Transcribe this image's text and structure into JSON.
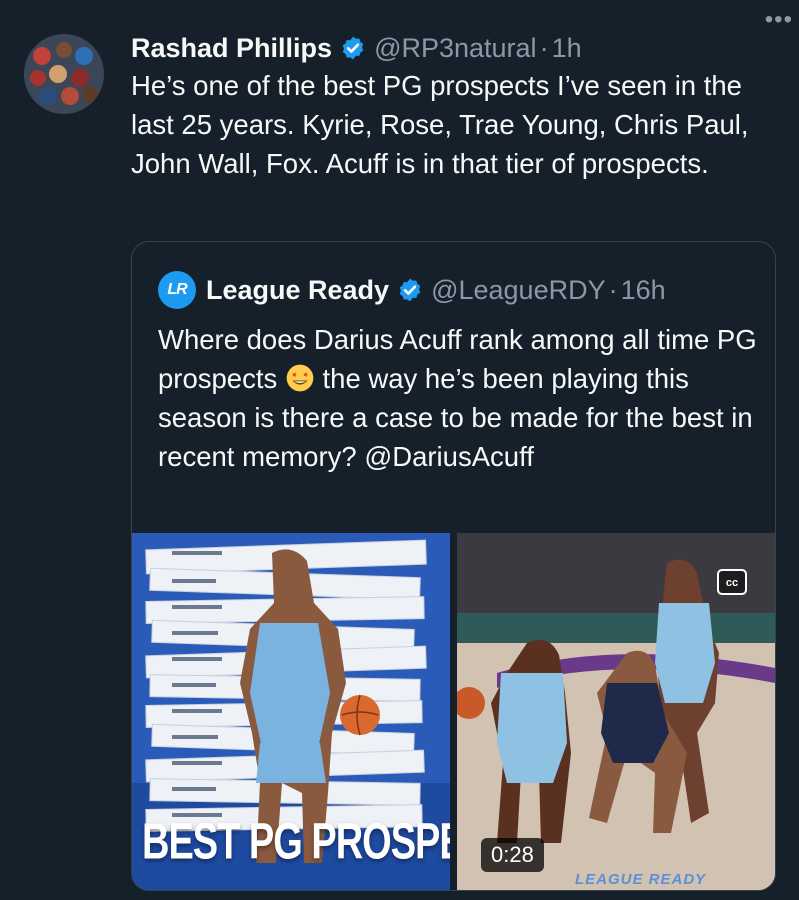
{
  "tweet": {
    "author_name": "Rashad Phillips",
    "handle": "@RP3natural",
    "separator": "·",
    "time": "1h",
    "more": "•••",
    "text": "He’s one of the best PG prospects I’ve seen in the last 25 years. Kyrie, Rose, Trae Young, Chris Paul, John Wall, Fox. Acuff is in that tier of prospects."
  },
  "quote": {
    "avatar_text": "LR",
    "author_name": "League Ready",
    "handle": "@LeagueRDY",
    "separator": "·",
    "time": "16h",
    "text_before_emoji": "Where does Darius Acuff rank among all time PG prospects ",
    "emoji": "star-struck-emoji",
    "text_after_emoji": " the way he’s been playing this season is there a case to be made for the best in recent memory? @DariusAcuff",
    "media": {
      "left_image_title": "BEST PG PROSPECTS?",
      "video_duration": "0:28",
      "watermark": "LEAGUE READY"
    }
  },
  "colors": {
    "background": "#15202b",
    "text": "#f7f9f9",
    "secondary_text": "#8b98a5",
    "verified": "#1d9bf0",
    "border": "#38444d"
  }
}
